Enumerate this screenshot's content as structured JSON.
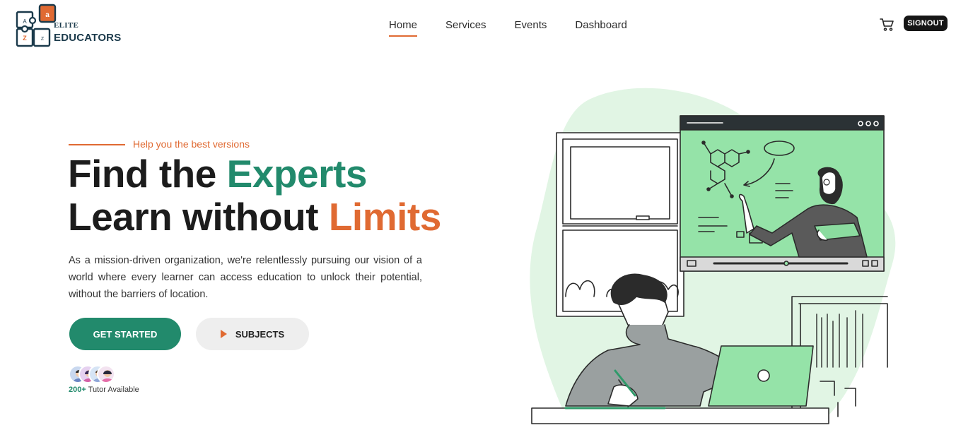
{
  "brand": {
    "tile_letters": [
      "a",
      "A",
      "Z",
      "Z"
    ],
    "top_word": "ELITE",
    "bottom_word": "EDUCATORS"
  },
  "nav": {
    "items": [
      {
        "label": "Home",
        "active": true
      },
      {
        "label": "Services",
        "active": false
      },
      {
        "label": "Events",
        "active": false
      },
      {
        "label": "Dashboard",
        "active": false
      }
    ],
    "signout_label": "SIGNOUT"
  },
  "hero": {
    "tagline": "Help you the best versions",
    "headline": {
      "line1_plain": "Find the ",
      "line1_highlight": "Experts",
      "line2_plain": "Learn without ",
      "line2_highlight": "Limits"
    },
    "description": "As a mission-driven organization, we're relentlessly pursuing our vision of a world where every learner can access education to unlock their potential, without the barriers of location.",
    "buttons": {
      "primary": "GET STARTED",
      "secondary": "SUBJECTS"
    },
    "tutors": {
      "count": "200+",
      "label": "Tutor Available"
    }
  },
  "colors": {
    "accent_green": "#228a6c",
    "accent_orange": "#e06a32",
    "dark": "#161616",
    "illustration_green": "#95e3a8"
  },
  "icons": [
    "cart-icon",
    "play-icon",
    "puzzle-logo-icon"
  ]
}
